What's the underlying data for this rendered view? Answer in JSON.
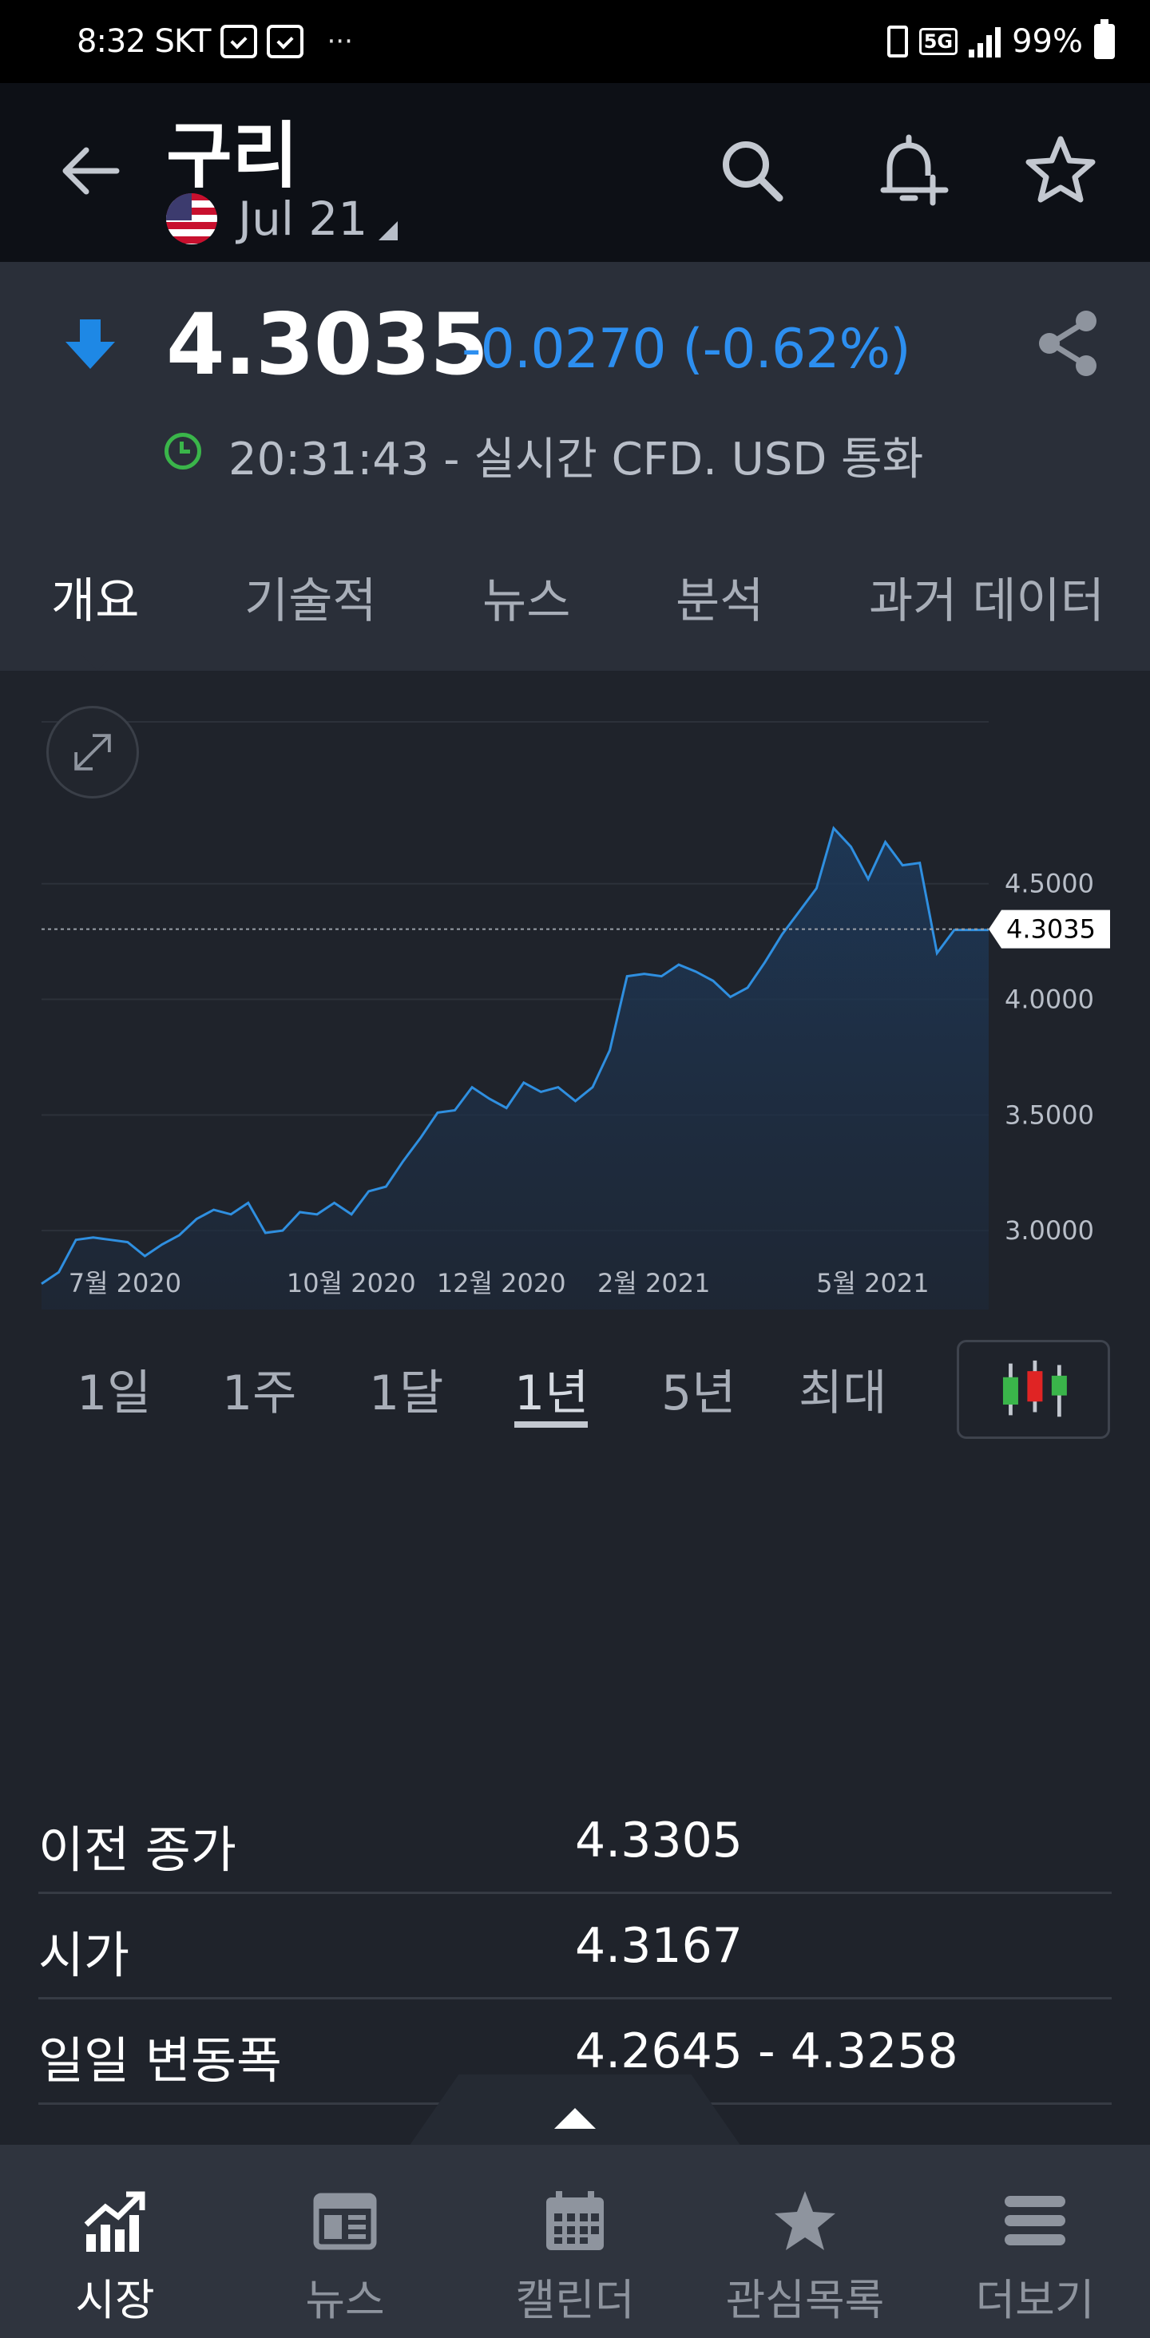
{
  "status_bar": {
    "time": "8:32 SKT",
    "dots": "···",
    "network": "5G",
    "battery": "99%"
  },
  "header": {
    "title": "구리",
    "contract": "Jul 21"
  },
  "quote": {
    "price": "4.3035",
    "change": "-0.0270 (-0.62%)",
    "time_info": "20:31:43 - 실시간 CFD. USD 통화",
    "down_color": "#1e88e5"
  },
  "tabs": [
    "개요",
    "기술적",
    "뉴스",
    "분석",
    "과거 데이터"
  ],
  "chart_data": {
    "type": "area",
    "title": "",
    "xlabel": "",
    "ylabel": "",
    "ylim": [
      2.7,
      5.2
    ],
    "y_ticks": [
      "4.5000",
      "4.0000",
      "3.5000",
      "3.0000"
    ],
    "x_ticks": [
      "7월 2020",
      "10월 2020",
      "12월 2020",
      "2월 2021",
      "5월 2021"
    ],
    "current_value_label": "4.3035",
    "current_value": 4.3035,
    "line_color": "#2f8fe0",
    "x": [
      "2020-06-01",
      "2020-06-08",
      "2020-06-15",
      "2020-06-22",
      "2020-06-29",
      "2020-07-06",
      "2020-07-13",
      "2020-07-20",
      "2020-07-27",
      "2020-08-03",
      "2020-08-10",
      "2020-08-17",
      "2020-08-24",
      "2020-08-31",
      "2020-09-07",
      "2020-09-14",
      "2020-09-21",
      "2020-09-28",
      "2020-10-05",
      "2020-10-12",
      "2020-10-19",
      "2020-10-26",
      "2020-11-02",
      "2020-11-09",
      "2020-11-16",
      "2020-11-23",
      "2020-11-30",
      "2020-12-07",
      "2020-12-14",
      "2020-12-21",
      "2020-12-28",
      "2021-01-04",
      "2021-01-11",
      "2021-01-18",
      "2021-01-25",
      "2021-02-01",
      "2021-02-08",
      "2021-02-15",
      "2021-02-22",
      "2021-03-01",
      "2021-03-08",
      "2021-03-15",
      "2021-03-22",
      "2021-03-29",
      "2021-04-05",
      "2021-04-12",
      "2021-04-19",
      "2021-04-26",
      "2021-05-03",
      "2021-05-10",
      "2021-05-17",
      "2021-05-24",
      "2021-05-31",
      "2021-06-07",
      "2021-06-14",
      "2021-06-21"
    ],
    "values": [
      2.77,
      2.82,
      2.96,
      2.97,
      2.96,
      2.95,
      2.89,
      2.94,
      2.98,
      3.05,
      3.09,
      3.07,
      3.12,
      2.99,
      3.0,
      3.08,
      3.07,
      3.12,
      3.07,
      3.17,
      3.19,
      3.3,
      3.4,
      3.51,
      3.52,
      3.62,
      3.57,
      3.53,
      3.64,
      3.6,
      3.62,
      3.56,
      3.62,
      3.78,
      4.1,
      4.11,
      4.1,
      4.15,
      4.12,
      4.08,
      4.01,
      4.05,
      4.16,
      4.28,
      4.38,
      4.48,
      4.74,
      4.66,
      4.52,
      4.68,
      4.58,
      4.59,
      4.2,
      4.3,
      4.3,
      4.3
    ]
  },
  "ranges": [
    "1일",
    "1주",
    "1달",
    "1년",
    "5년",
    "최대"
  ],
  "active_range": "1년",
  "stats": [
    {
      "label": "이전 종가",
      "value": "4.3305"
    },
    {
      "label": "시가",
      "value": "4.3167"
    },
    {
      "label": "일일 변동폭",
      "value": "4.2645 - 4.3258"
    }
  ],
  "bottom_nav": [
    {
      "label": "시장",
      "icon": "chart-growth-icon"
    },
    {
      "label": "뉴스",
      "icon": "newspaper-icon"
    },
    {
      "label": "캘린더",
      "icon": "calendar-icon"
    },
    {
      "label": "관심목록",
      "icon": "star-icon"
    },
    {
      "label": "더보기",
      "icon": "menu-icon"
    }
  ]
}
